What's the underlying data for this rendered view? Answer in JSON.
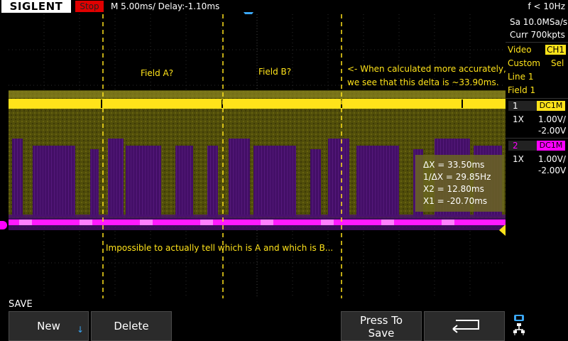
{
  "header": {
    "brand": "SIGLENT",
    "run_state": "Stop",
    "timebase": "M 5.00ms/ Delay:-1.10ms",
    "trigger_freq": "f < 10Hz"
  },
  "acquisition": {
    "sample_rate": "Sa 10.0MSa/s",
    "memory_depth": "Curr 700kpts"
  },
  "trigger_panel": {
    "type": "Video",
    "source": "CH1",
    "standard": "Custom",
    "select": "Sel",
    "line": "Line 1",
    "field": "Field 1"
  },
  "channels": [
    {
      "num": "1",
      "coupling": "DC1M",
      "probe": "1X",
      "scale": "1.00V/",
      "offset": "-2.00V",
      "color": "#ffe31a"
    },
    {
      "num": "2",
      "coupling": "DC1M",
      "probe": "1X",
      "scale": "1.00V/",
      "offset": "-2.00V",
      "color": "#ff00ff"
    }
  ],
  "annotations": {
    "field_a": "Field A?",
    "field_b": "Field B?",
    "note_line1": "<- When calculated more accurately,",
    "note_line2": "we see that this delta is ~33.90ms.",
    "bottom_note": "Impossible to actually tell which is A and which is B..."
  },
  "cursor_readout": {
    "delta_x": "ΔX = 33.50ms",
    "inv_delta_x": "1/ΔX = 29.85Hz",
    "x2": "X2 = 12.80ms",
    "x1": "X1 = -20.70ms"
  },
  "menu": {
    "title": "SAVE",
    "new": "New",
    "delete": "Delete",
    "press_to_save_line1": "Press To",
    "press_to_save_line2": "Save"
  },
  "colors": {
    "ch1": "#ffe31a",
    "ch2": "#ff00ff",
    "cursor": "#ffe31a",
    "trigger_marker": "#3aa7f5",
    "stop_badge": "#e00000"
  },
  "icons": {
    "back": "return-arrow-icon",
    "network": "network-icon",
    "new_dropdown": "chevron-down-icon"
  }
}
